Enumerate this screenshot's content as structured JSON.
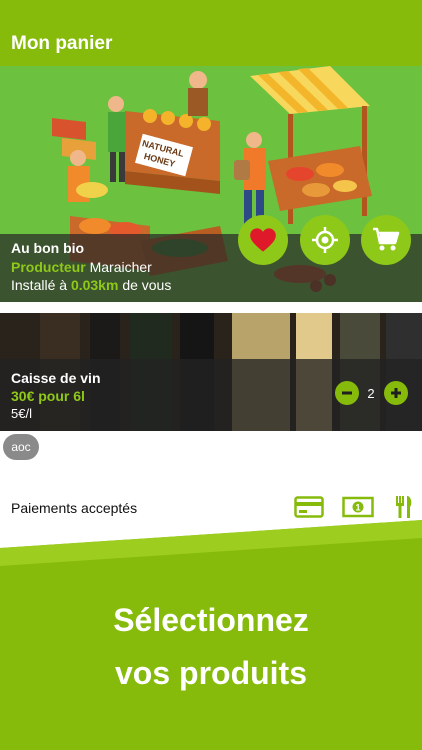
{
  "header": {
    "title": "Mon panier"
  },
  "shop": {
    "name": "Au bon bio",
    "type_label": "Producteur",
    "type_value": "Maraicher",
    "distance_prefix": "Installé à",
    "distance": "0.03km",
    "distance_suffix": "de vous",
    "illustration": {
      "sign_text": "NATURAL HONEY"
    }
  },
  "actions": {
    "favorite_icon": "heart-icon",
    "locate_icon": "crosshair-icon",
    "cart_icon": "cart-icon"
  },
  "product": {
    "name": "Caisse de vin",
    "offer": "30€ pour 6l",
    "unit_price": "5€/l",
    "quantity": "2",
    "tag": "aoc"
  },
  "payments": {
    "label": "Paiements acceptés",
    "icons": [
      "card-icon",
      "cash-icon",
      "meal-voucher-icon"
    ]
  },
  "promo": {
    "line1": "Sélectionnez",
    "line2": "vos produits"
  },
  "colors": {
    "brand_green": "#86bb0b",
    "accent_green": "#8ec919",
    "overlay": "#2d2d2d"
  }
}
